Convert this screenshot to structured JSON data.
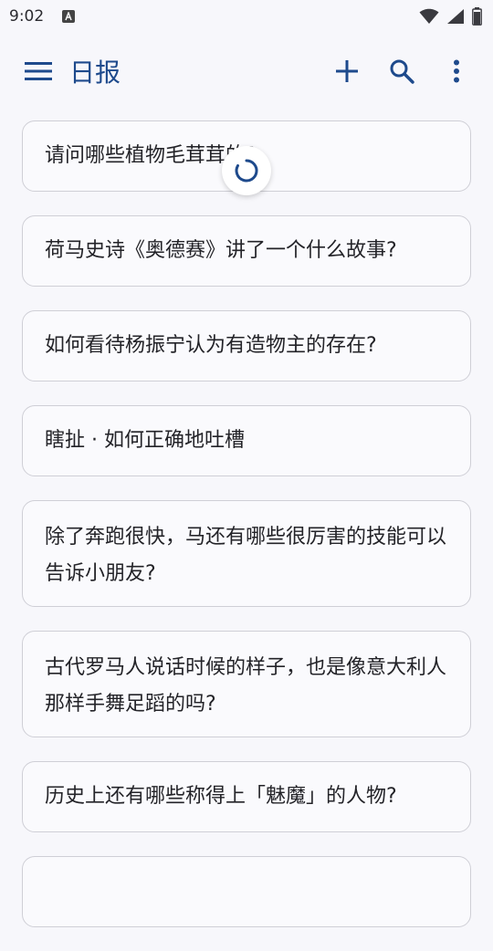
{
  "status": {
    "time": "9:02"
  },
  "app_bar": {
    "title": "日报"
  },
  "items": [
    {
      "title": "请问哪些植物毛茸茸的?"
    },
    {
      "title": "荷马史诗《奥德赛》讲了一个什么故事?"
    },
    {
      "title": "如何看待杨振宁认为有造物主的存在?"
    },
    {
      "title": "瞎扯 · 如何正确地吐槽"
    },
    {
      "title": "除了奔跑很快，马还有哪些很厉害的技能可以告诉小朋友?"
    },
    {
      "title": "古代罗马人说话时候的样子，也是像意大利人那样手舞足蹈的吗?"
    },
    {
      "title": "历史上还有哪些称得上「魅魔」的人物?"
    }
  ],
  "colors": {
    "accent": "#1e4a8c",
    "background": "#f7f7fb",
    "card_border": "#cfcfd6"
  },
  "icons": [
    "menu-icon",
    "add-icon",
    "search-icon",
    "more-vert-icon",
    "wifi-icon",
    "signal-icon",
    "battery-icon",
    "refresh-spinner-icon"
  ]
}
